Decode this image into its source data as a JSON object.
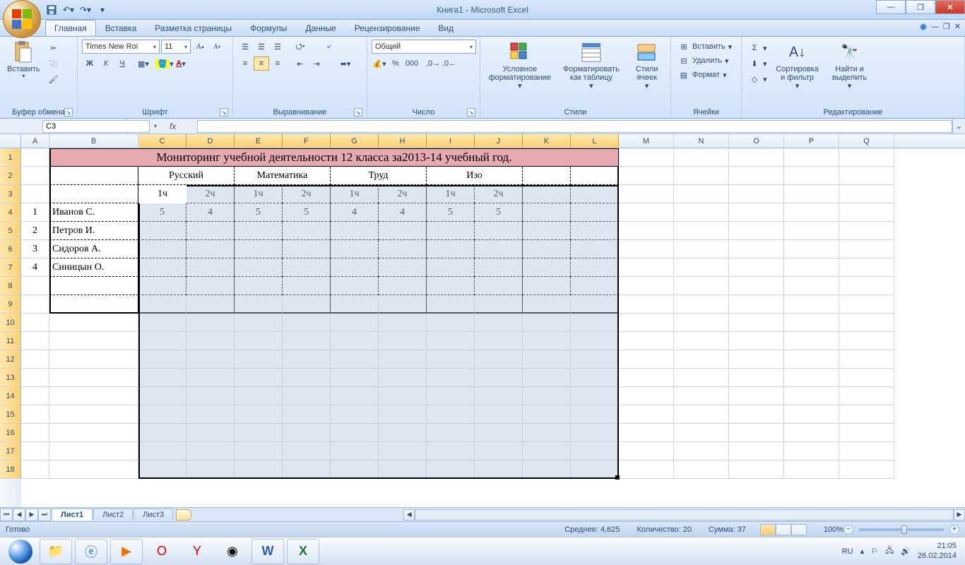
{
  "title": "Книга1 - Microsoft Excel",
  "qat": {
    "save": "save-icon",
    "undo": "undo-icon",
    "redo": "redo-icon"
  },
  "tabs": {
    "items": [
      "Главная",
      "Вставка",
      "Разметка страницы",
      "Формулы",
      "Данные",
      "Рецензирование",
      "Вид"
    ],
    "active": 0
  },
  "ribbon": {
    "clipboard": {
      "paste": "Вставить",
      "title": "Буфер обмена"
    },
    "font": {
      "name": "Times New Roi",
      "size": "11",
      "title": "Шрифт",
      "bold": "Ж",
      "italic": "К",
      "underline": "Ч"
    },
    "alignment": {
      "title": "Выравнивание"
    },
    "number": {
      "format": "Общий",
      "title": "Число"
    },
    "styles": {
      "cond": "Условное форматирование",
      "table": "Форматировать как таблицу",
      "cell": "Стили ячеек",
      "title": "Стили"
    },
    "cells": {
      "insert": "Вставить",
      "delete": "Удалить",
      "format": "Формат",
      "title": "Ячейки"
    },
    "editing": {
      "sort": "Сортировка и фильтр",
      "find": "Найти и выделить",
      "title": "Редактирование"
    }
  },
  "namebox": "C3",
  "columns": [
    {
      "l": "A",
      "w": 40
    },
    {
      "l": "B",
      "w": 126
    },
    {
      "l": "C",
      "w": 68
    },
    {
      "l": "D",
      "w": 68
    },
    {
      "l": "E",
      "w": 68
    },
    {
      "l": "F",
      "w": 68
    },
    {
      "l": "G",
      "w": 68
    },
    {
      "l": "H",
      "w": 68
    },
    {
      "l": "I",
      "w": 68
    },
    {
      "l": "J",
      "w": 68
    },
    {
      "l": "K",
      "w": 68
    },
    {
      "l": "L",
      "w": 68
    },
    {
      "l": "M",
      "w": 78
    },
    {
      "l": "N",
      "w": 78
    },
    {
      "l": "O",
      "w": 78
    },
    {
      "l": "P",
      "w": 78
    },
    {
      "l": "Q",
      "w": 78
    }
  ],
  "row_count": 18,
  "selected_rows": [
    1,
    2,
    3,
    4,
    5,
    6,
    7,
    8,
    9,
    10,
    11,
    12,
    13,
    14,
    15,
    16,
    17,
    18
  ],
  "selected_cols": [
    "C",
    "D",
    "E",
    "F",
    "G",
    "H",
    "I",
    "J",
    "K",
    "L"
  ],
  "merge_title": {
    "text": "Мониторинг учебной деятельности 12 класса за2013-14 учебный год.",
    "from_col": 1,
    "to_col": 11
  },
  "subjects": [
    "Русский",
    "Математика",
    "Труд",
    "Изо"
  ],
  "quarters": [
    "1ч",
    "2ч",
    "1ч",
    "2ч",
    "1ч",
    "2ч",
    "1ч",
    "2ч"
  ],
  "students": [
    {
      "n": "1",
      "name": "Иванов С.",
      "marks": [
        "5",
        "4",
        "5",
        "5",
        "4",
        "4",
        "5",
        "5"
      ]
    },
    {
      "n": "2",
      "name": "Петров И.",
      "marks": [
        "",
        "",
        "",
        "",
        "",
        "",
        "",
        ""
      ]
    },
    {
      "n": "3",
      "name": "Сидоров А.",
      "marks": [
        "",
        "",
        "",
        "",
        "",
        "",
        "",
        ""
      ]
    },
    {
      "n": "4",
      "name": "Синицын О.",
      "marks": [
        "",
        "",
        "",
        "",
        "",
        "",
        "",
        ""
      ]
    }
  ],
  "sheets": {
    "items": [
      "Лист1",
      "Лист2",
      "Лист3"
    ],
    "active": 0
  },
  "status": {
    "ready": "Готово",
    "avg": "Среднее: 4,625",
    "count": "Количество: 20",
    "sum": "Сумма: 37",
    "zoom": "100%"
  },
  "tray": {
    "lang": "RU",
    "time": "21:05",
    "date": "26.02.2014"
  }
}
